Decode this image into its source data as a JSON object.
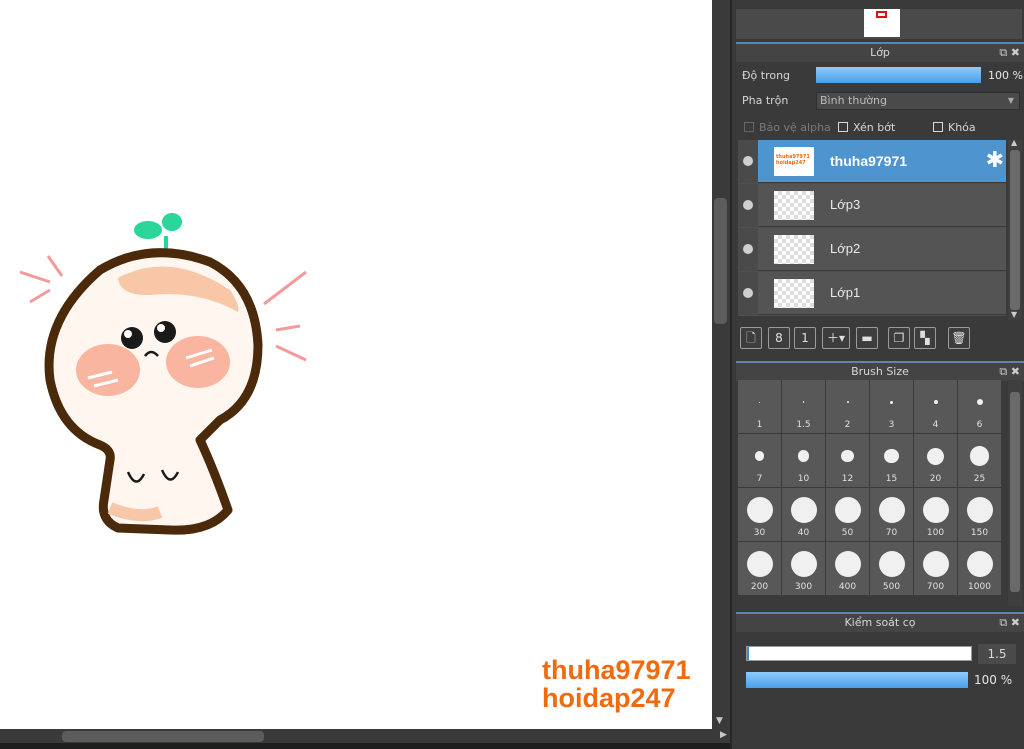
{
  "canvas": {
    "watermark_line1": "thuha97971",
    "watermark_line2": "hoidap247"
  },
  "layers_panel": {
    "title": "Lớp",
    "opacity_label": "Độ trong",
    "opacity_value": "100 %",
    "opacity_fraction": 1.0,
    "blend_label": "Pha trộn",
    "blend_value": "Bình thường",
    "protect_alpha": "Bảo vệ alpha",
    "clipping": "Xén bớt",
    "lock": "Khóa",
    "layers": [
      {
        "name": "thuha97971",
        "active": true,
        "thumb_text": "thuha97971 hoidap247"
      },
      {
        "name": "Lớp3",
        "active": false
      },
      {
        "name": "Lớp2",
        "active": false
      },
      {
        "name": "Lớp1",
        "active": false
      }
    ]
  },
  "brush_size_panel": {
    "title": "Brush Size",
    "sizes": [
      "1",
      "1.5",
      "2",
      "3",
      "4",
      "6",
      "7",
      "10",
      "12",
      "15",
      "20",
      "25",
      "30",
      "40",
      "50",
      "70",
      "100",
      "150",
      "200",
      "300",
      "400",
      "500",
      "700",
      "1000"
    ]
  },
  "brush_control_panel": {
    "title": "Kiểm soát cọ",
    "size_value": "1.5",
    "density_value": "100 %",
    "density_fraction": 1.0
  },
  "colors": {
    "accent": "#4e94cf",
    "watermark": "#f06a0f",
    "panel_bg": "#3a3a3a"
  },
  "icons": {
    "dock": "dock-icon",
    "close": "close-icon",
    "gear": "gear-icon"
  }
}
